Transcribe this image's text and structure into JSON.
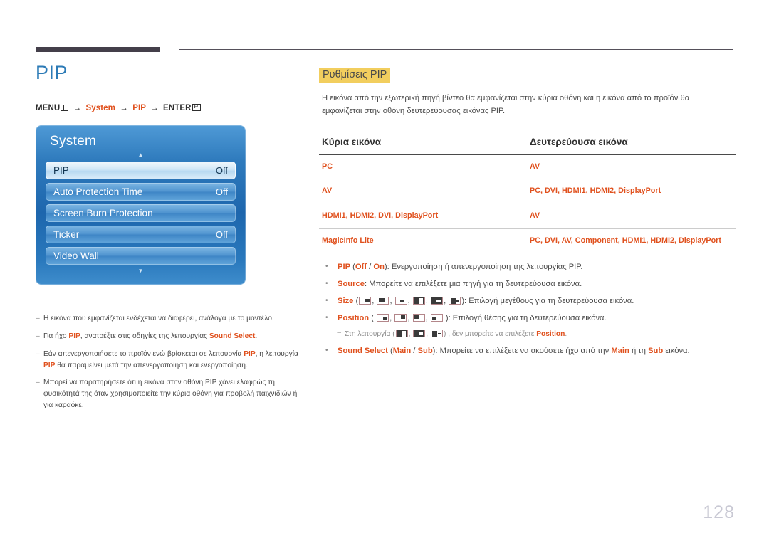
{
  "document": {
    "page_number": "128",
    "accent_orange": "#e0511e",
    "title_blue": "#2b7ab6",
    "highlight_yellow": "#f2ce5e"
  },
  "left": {
    "page_title": "PIP",
    "menu_path": {
      "menu_label": "MENU",
      "arrow": "→",
      "step1": "System",
      "step2": "PIP",
      "enter_label": "ENTER"
    },
    "osd": {
      "title": "System",
      "up_arrow": "▲",
      "down_arrow": "▼",
      "rows": [
        {
          "label": "PIP",
          "value": "Off",
          "selected": true
        },
        {
          "label": "Auto Protection Time",
          "value": "Off",
          "selected": false
        },
        {
          "label": "Screen Burn Protection",
          "value": "",
          "selected": false
        },
        {
          "label": "Ticker",
          "value": "Off",
          "selected": false
        },
        {
          "label": "Video Wall",
          "value": "",
          "selected": false
        }
      ]
    },
    "footnotes": [
      {
        "dash": "–",
        "html": "Η εικόνα που εμφανίζεται ενδέχεται να διαφέρει, ανάλογα με το μοντέλο."
      },
      {
        "dash": "–",
        "html": "Για ήχο <b class=\"o\">PIP</b>, ανατρέξτε στις οδηγίες της λειτουργίας <b class=\"o\">Sound Select</b>."
      },
      {
        "dash": "–",
        "html": "Εάν απενεργοποιήσετε το προϊόν ενώ βρίσκεται σε λειτουργία <b class=\"o\">PIP</b>, η λειτουργία <b class=\"o\">PIP</b> θα παραμείνει μετά την απενεργοποίηση και ενεργοποίηση."
      },
      {
        "dash": "–",
        "html": "Μπορεί να παρατηρήσετε ότι η εικόνα στην οθόνη PIP χάνει ελαφρώς τη φυσικότητά της όταν χρησιμοποιείτε την κύρια οθόνη για προβολή παιχνιδιών ή για καραόκε."
      }
    ]
  },
  "right": {
    "section_heading": "Ρυθμίσεις PIP",
    "intro": "Η εικόνα από την εξωτερική πηγή βίντεο θα εμφανίζεται στην κύρια οθόνη και η εικόνα από το προϊόν θα εμφανίζεται στην οθόνη δευτερεύουσας εικόνας PIP.",
    "table": {
      "headers": [
        "Κύρια εικόνα",
        "Δευτερεύουσα εικόνα"
      ],
      "rows": [
        {
          "main": "PC",
          "sub": "AV"
        },
        {
          "main": "AV",
          "sub": "PC, DVI, HDMI1, HDMI2, DisplayPort"
        },
        {
          "main": "HDMI1, HDMI2, DVI, DisplayPort",
          "sub": "AV"
        },
        {
          "main": "MagicInfo Lite",
          "sub": "PC, DVI, AV, Component, HDMI1, HDMI2, DisplayPort"
        }
      ]
    },
    "bullets": {
      "bullet_char": "•",
      "items": [
        {
          "html": "<b class=\"o\">PIP</b> (<b class=\"o\">Off</b> / <b class=\"o\">On</b>): Ενεργοποίηση ή απενεργοποίηση της λειτουργίας PIP."
        },
        {
          "html": "<b class=\"o\">Source</b>: Μπορείτε να επιλέξετε μια πηγή για τη δευτερεύουσα εικόνα."
        },
        {
          "html": "<b class=\"o\">Size</b> (<span class=\"g s1\"><i></i></span>, <span class=\"g s2\"><i></i></span>, <span class=\"g s3\"><i></i></span>, <span class=\"g half\"><i></i></span>, <span class=\"g half2\"><i></i></span>, <span class=\"g dash-r\"><i class=\"blk\"></i><i class=\"ln\"></i></span>): Επιλογή μεγέθους για τη δευτερεύουσα εικόνα."
        },
        {
          "html": "<b class=\"o\">Position</b> ( <span class=\"g p-br\"><i></i></span>, <span class=\"g p-tr\"><i></i></span>, <span class=\"g p-tl\"><i></i></span>, <span class=\"g p-bl\"><i></i></span> ): Επιλογή θέσης για τη δευτερεύουσα εικόνα."
        }
      ],
      "subnote": {
        "dash": "–",
        "html": "Στη λειτουργία (<span class=\"g half\"><i></i></span>, <span class=\"g half2\"><i></i></span>, <span class=\"g dash-r\"><i class=\"blk\"></i><i class=\"ln\"></i></span>) , δεν μπορείτε να επιλέξετε <b class=\"o\">Position</b>."
      },
      "last_item": {
        "html": "<b class=\"o\">Sound Select</b> (<b class=\"o\">Main</b> / <b class=\"o\">Sub</b>): Μπορείτε να επιλέξετε να ακούσετε ήχο από την <b class=\"o\">Main</b> ή τη <b class=\"o\">Sub</b> εικόνα."
      }
    }
  }
}
